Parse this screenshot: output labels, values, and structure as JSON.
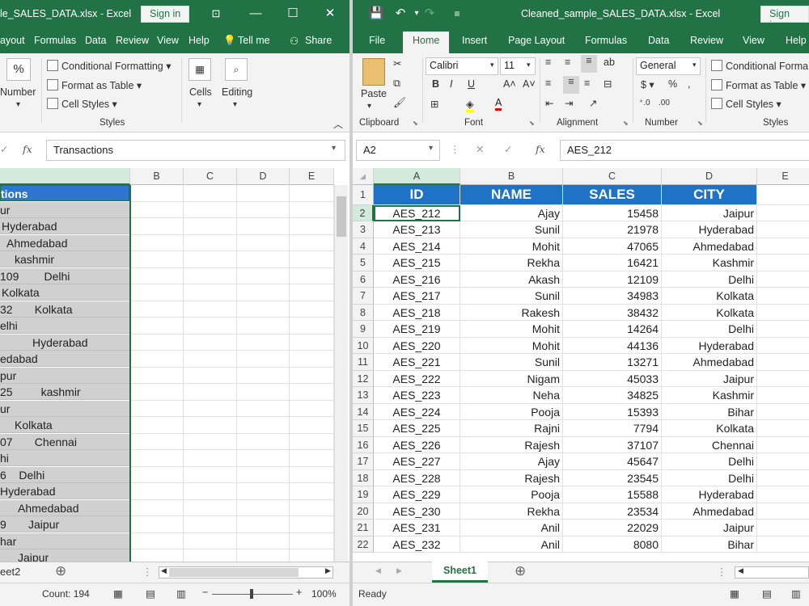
{
  "left": {
    "title": "le_SALES_DATA.xlsx  -  Excel",
    "signin": "Sign in",
    "tabs": [
      "ayout",
      "Formulas",
      "Data",
      "Review",
      "View",
      "Help",
      "Tell me",
      "Share"
    ],
    "ribbon": {
      "number": "Number",
      "percent": "%",
      "cond_fmt": "Conditional Formatting",
      "fmt_table": "Format as Table",
      "cell_styles": "Cell Styles",
      "styles_group": "Styles",
      "cells": "Cells",
      "editing": "Editing"
    },
    "fx": "fx",
    "formula": "Transactions",
    "columns": [
      "B",
      "C",
      "D",
      "E"
    ],
    "header": "tions",
    "cells": [
      "ur",
      "Hyderabad",
      "Ahmedabad",
      "kashmir",
      "109        Delhi",
      "Kolkata",
      "32       Kolkata",
      "elhi",
      "Hyderabad",
      "edabad",
      "pur",
      "25         kashmir",
      "ur",
      "Kolkata",
      "07       Chennai",
      "hi",
      "6    Delhi",
      "Hyderabad",
      "Ahmedabad",
      "9       Jaipur",
      "har",
      "Jaipur"
    ],
    "sheet_tab": "eet2",
    "status_count": "Count: 194",
    "zoom": "100%"
  },
  "right": {
    "title": "Cleaned_sample_SALES_DATA.xlsx  -  Excel",
    "signin": "Sign in",
    "tabs": [
      "File",
      "Home",
      "Insert",
      "Page Layout",
      "Formulas",
      "Data",
      "Review",
      "View",
      "Help"
    ],
    "ribbon": {
      "paste": "Paste",
      "clipboard": "Clipboard",
      "font_name": "Calibri",
      "font_size": "11",
      "font": "Font",
      "alignment": "Alignment",
      "number_format": "General",
      "number": "Number",
      "cond_fmt": "Conditional Forma",
      "fmt_table": "Format as Table",
      "cell_styles": "Cell Styles",
      "styles": "Styles"
    },
    "namebox": "A2",
    "fx": "fx",
    "formula": "AES_212",
    "columns": [
      "A",
      "B",
      "C",
      "D",
      "E"
    ],
    "headers": [
      "ID",
      "NAME",
      "SALES",
      "CITY"
    ],
    "rows": [
      [
        "AES_212",
        "Ajay",
        "15458",
        "Jaipur"
      ],
      [
        "AES_213",
        "Sunil",
        "21978",
        "Hyderabad"
      ],
      [
        "AES_214",
        "Mohit",
        "47065",
        "Ahmedabad"
      ],
      [
        "AES_215",
        "Rekha",
        "16421",
        "Kashmir"
      ],
      [
        "AES_216",
        "Akash",
        "12109",
        "Delhi"
      ],
      [
        "AES_217",
        "Sunil",
        "34983",
        "Kolkata"
      ],
      [
        "AES_218",
        "Rakesh",
        "38432",
        "Kolkata"
      ],
      [
        "AES_219",
        "Mohit",
        "14264",
        "Delhi"
      ],
      [
        "AES_220",
        "Mohit",
        "44136",
        "Hyderabad"
      ],
      [
        "AES_221",
        "Sunil",
        "13271",
        "Ahmedabad"
      ],
      [
        "AES_222",
        "Nigam",
        "45033",
        "Jaipur"
      ],
      [
        "AES_223",
        "Neha",
        "34825",
        "Kashmir"
      ],
      [
        "AES_224",
        "Pooja",
        "15393",
        "Bihar"
      ],
      [
        "AES_225",
        "Rajni",
        "7794",
        "Kolkata"
      ],
      [
        "AES_226",
        "Rajesh",
        "37107",
        "Chennai"
      ],
      [
        "AES_227",
        "Ajay",
        "45647",
        "Delhi"
      ],
      [
        "AES_228",
        "Rajesh",
        "23545",
        "Delhi"
      ],
      [
        "AES_229",
        "Pooja",
        "15588",
        "Hyderabad"
      ],
      [
        "AES_230",
        "Rekha",
        "23534",
        "Ahmedabad"
      ],
      [
        "AES_231",
        "Anil",
        "22029",
        "Jaipur"
      ],
      [
        "AES_232",
        "Anil",
        "8080",
        "Bihar"
      ]
    ],
    "sheet_tab": "Sheet1",
    "status": "Ready"
  },
  "colors": {
    "excel_green": "#217346",
    "header_blue": "#1f73c7",
    "selection_gray": "#d0d0d0"
  }
}
